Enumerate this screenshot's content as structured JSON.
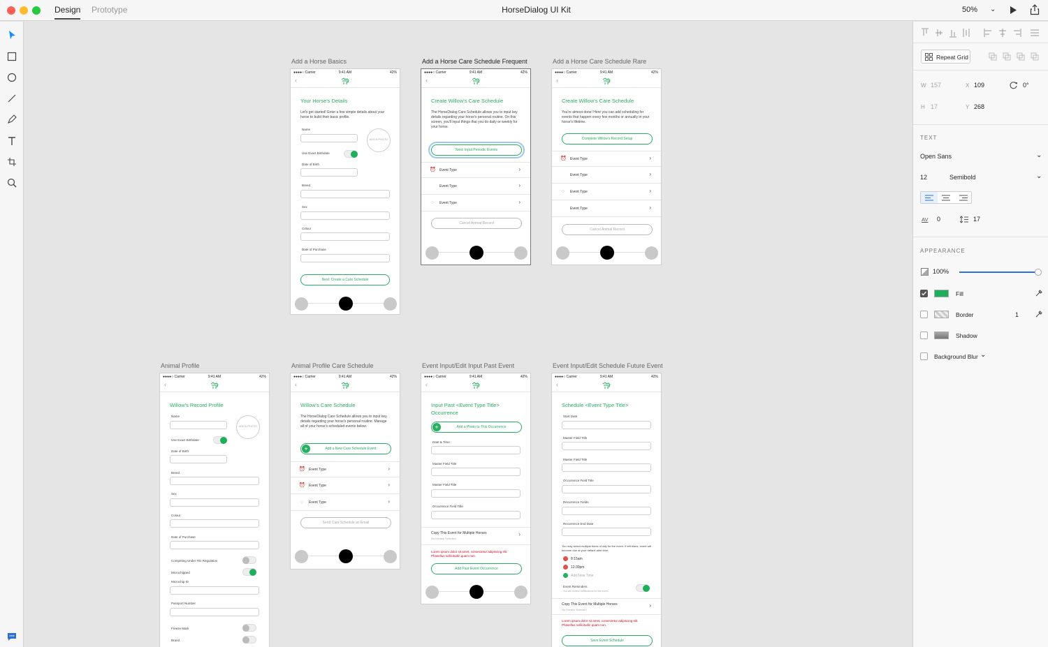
{
  "app": {
    "window_title": "HorseDialog UI Kit",
    "tabs": [
      "Design",
      "Prototype"
    ],
    "zoom": "50%"
  },
  "colors": {
    "accent": "#27ae60",
    "toggle_on": "#1fae5b",
    "error": "#d0021b",
    "record_dot": "#d9534f"
  },
  "common": {
    "carrier": "●●●●○ Carrier",
    "time": "9:41 AM",
    "battery": "42%"
  },
  "artboards": {
    "basics": {
      "label": "Add a Horse Basics",
      "heading": "Your Horse's Details",
      "intro": "Let's get started! Enter a few simple details about your horse to build their basic profile.",
      "fields": [
        "Name",
        "Date of Birth",
        "Breed",
        "Sex",
        "Colour",
        "Date of Purchase"
      ],
      "toggle_label": "Use Exact Birthdate",
      "photo": "ADD A PHOTO",
      "button": "Next: Create a Care Schedule"
    },
    "frequent": {
      "label": "Add a Horse Care Schedule Frequent",
      "heading": "Create Willow's Care Schedule",
      "intro": "The HorseDialog Care Schedule allows you to input key details regarding your horse's personal routine. On this screen, you'll input things that you do daily or weekly for your horse.",
      "button": "Next: Input Periodic Events",
      "events": [
        "Event Type",
        "Event Type",
        "Event Type"
      ],
      "cancel": "Cancel Animal Record"
    },
    "rare": {
      "label": "Add a Horse Care Schedule Rare",
      "heading": "Create Willow's Care Schedule",
      "intro": "You're almost done! Here you can add scheduling for events that happen every few months or annually in your horse's lifetime.",
      "button": "Complete Willow's Record Setup",
      "events": [
        "Event Type",
        "Event Type",
        "Event Type",
        "Event Type"
      ],
      "cancel": "Cancel Animal Record"
    },
    "profile": {
      "label": "Animal Profile",
      "heading": "Willow's Record Profile",
      "fields": [
        "Name",
        "Date of Birth",
        "Breed",
        "Sex",
        "Colour",
        "Date of Purchase"
      ],
      "toggle_label": "Use Exact Birthdate",
      "photo": "ADD A PHOTO",
      "toggles": [
        "Competing Under FEI Regulation",
        "Microchipped"
      ],
      "fields2": [
        "Microchip ID",
        "Passport Number"
      ],
      "toggles2": [
        "Freeze Mark",
        "Brand"
      ]
    },
    "profile_care": {
      "label": "Animal Profile Care Schedule",
      "heading": "Willow's Care Schedule",
      "intro": "The HorseDialog Care Schedule allows you to input key details regarding your horse's personal routine. Manage all of your horse's scheduled events below.",
      "button": "Add a New Care Schedule Event",
      "events": [
        "Event Type",
        "Event Type",
        "Event Type"
      ],
      "email": "Send Care Schedule as Email"
    },
    "past": {
      "label": "Event Input/Edit Input Past Event",
      "heading1": "Input Past <Event Type Title>",
      "heading2": "Occurrence",
      "photo_button": "Add a Photo to This Occurrence",
      "fields": [
        "Date & Time",
        "Master Field Title",
        "Master Field Title",
        "Occurrence Field Title"
      ],
      "copy": "Copy This Event for Multiple Horses",
      "copy_sub": "No Horses Selected",
      "error": "Lorem ipsum dolor sit amet, consectetur adipiscing elit. Phasellus sollicitudin quam non.",
      "button": "Add Past Event Occurrence"
    },
    "future": {
      "label": "Event Input/Edit Schedule Future Event",
      "heading": "Schedule <Event Type Title>",
      "fields": [
        "Start Date",
        "Master Field Title",
        "Master Field Title",
        "Occurrence Field Title",
        "Recurrence Fields",
        "Recurrence End Date"
      ],
      "note": "You may select multiple times of day for the event. If left blank, event will become due at your default alert time.",
      "times": [
        "8:15am",
        "12:30pm"
      ],
      "add_time": "Add New Time",
      "reminders": "Event Reminders",
      "reminders_sub": "You will receive notifications for this event.",
      "copy": "Copy This Event for Multiple Horses",
      "copy_sub": "No Horses Selected",
      "error": "Lorem ipsum dolor sit amet, consectetur adipiscing elit. Phasellus sollicitudin quam non.",
      "button": "Save Event Schedule"
    }
  },
  "inspector": {
    "repeat_grid": "Repeat Grid",
    "w_label": "W",
    "w": "157",
    "x_label": "X",
    "x": "109",
    "rotation": "0°",
    "h_label": "H",
    "h": "17",
    "y_label": "Y",
    "y": "268",
    "text_title": "TEXT",
    "font": "Open Sans",
    "size": "12",
    "weight": "Semibold",
    "av_label": "AV",
    "char_spacing": "0",
    "line_spacing": "17",
    "appearance_title": "APPEARANCE",
    "opacity": "100%",
    "opacity_value": 1.0,
    "fill": "Fill",
    "border": "Border",
    "border_width": "1",
    "shadow": "Shadow",
    "background_blur": "Background Blur"
  }
}
